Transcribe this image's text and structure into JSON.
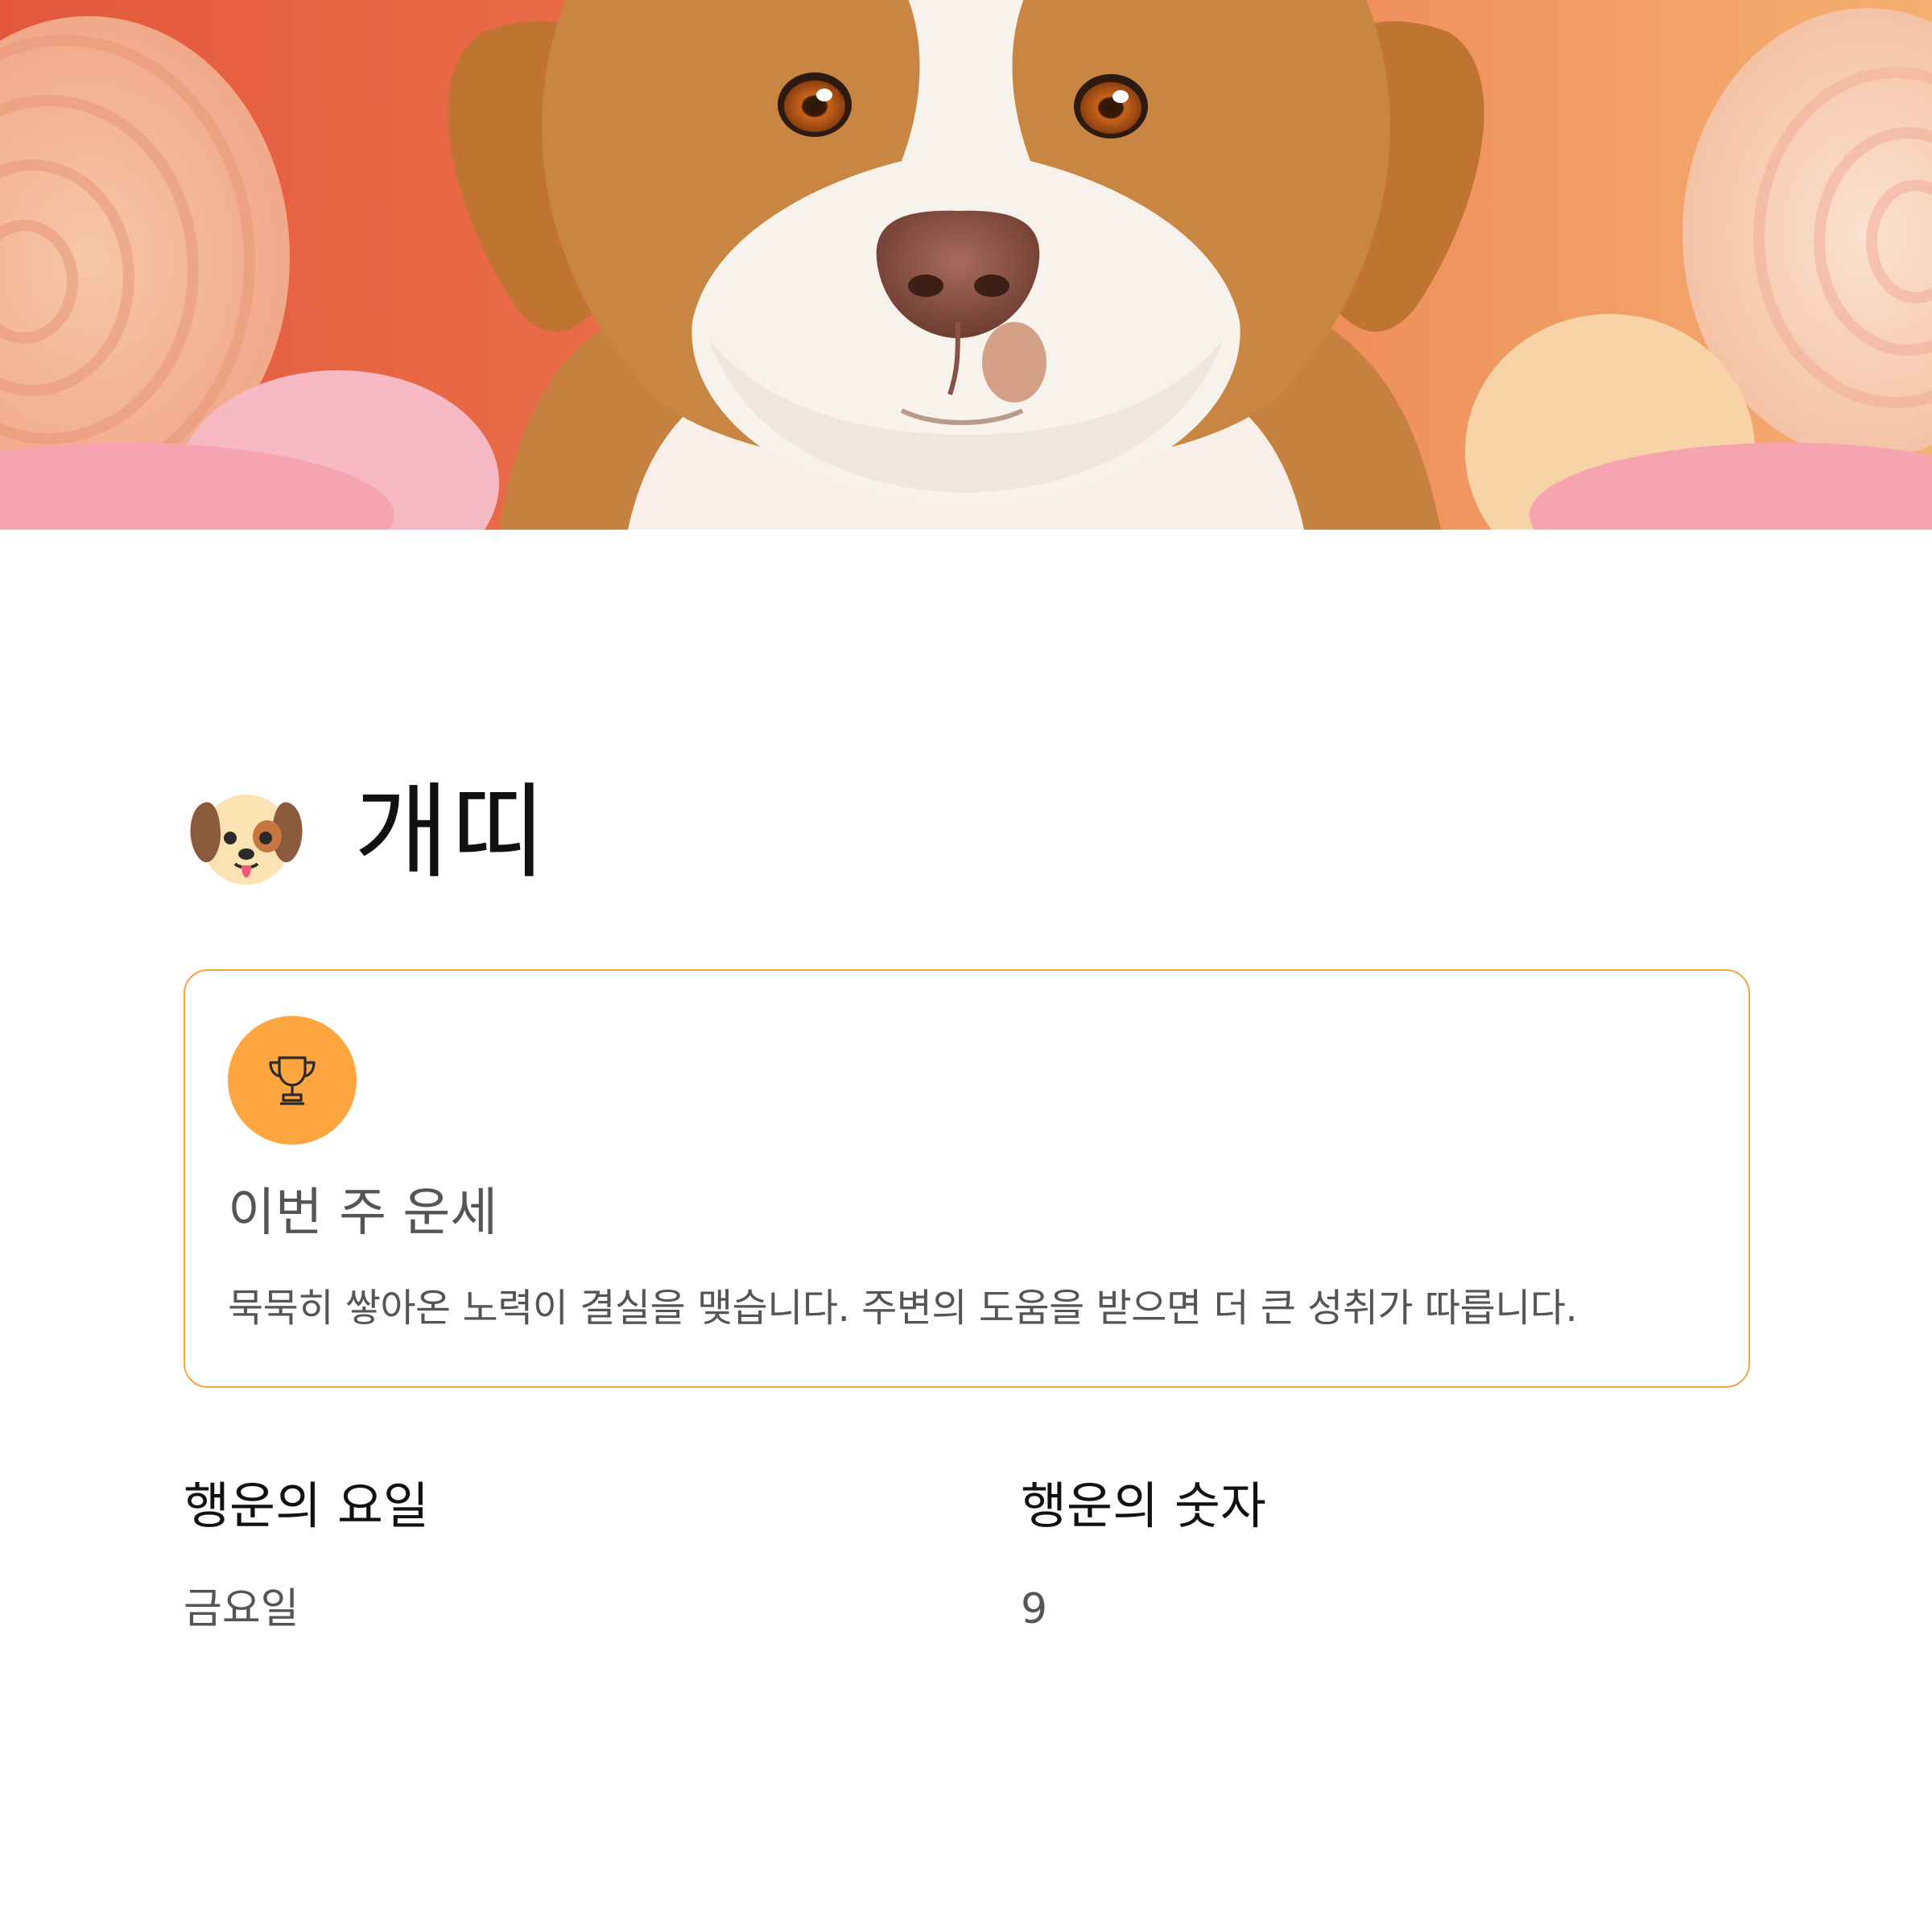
{
  "hero": {
    "image": "dog-portrait-illustration",
    "colors": {
      "background_left": "#e9694a",
      "background_right": "#f3a668",
      "fur_tan": "#c07a3c",
      "fur_white": "#faf4ef"
    }
  },
  "zodiac": {
    "icon": "dog-face-icon",
    "name": "개띠"
  },
  "fortune": {
    "icon": "trophy-icon",
    "title": "이번 주 운세",
    "description": "묵묵히 쌓아온 노력이 결실을 맺습니다. 주변의 도움을 받으면 더 큰 성취가 따릅니다.",
    "colors": {
      "accent": "#fda53e",
      "border": "#f3a640"
    }
  },
  "lucky": {
    "day_label": "행운의 요일",
    "day_value": "금요일",
    "number_label": "행운의 숫자",
    "number_value": "9"
  }
}
